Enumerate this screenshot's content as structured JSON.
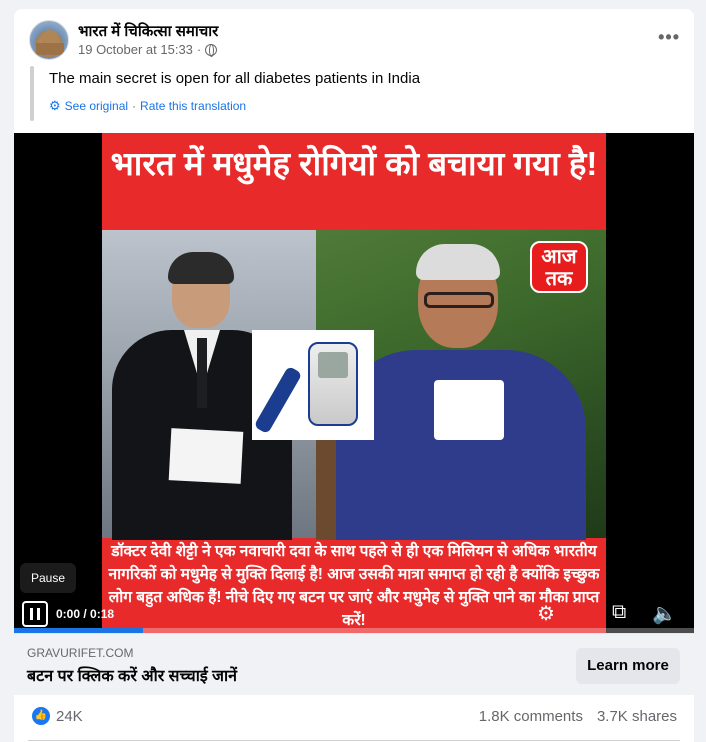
{
  "post": {
    "page_name": "भारत में चिकित्सा समाचार",
    "timestamp": "19 October at 15:33",
    "privacy_icon": "globe-icon",
    "menu_icon": "more-horizontal-icon",
    "menu_glyph": "•••"
  },
  "translation": {
    "text": "The main secret is open for all diabetes patients in India",
    "see_original": "See original",
    "separator": "·",
    "rate": "Rate this translation"
  },
  "video": {
    "headline": "भारत में मधुमेह रोगियों को बचाया गया है!",
    "logo": "आज तक",
    "caption": "डॉक्टर देवी शेट्टी ने एक नवाचारी दवा के साथ पहले से ही एक मिलियन से अधिक भारतीय नागरिकों को मधुमेह से मुक्ति दिलाई है! आज उसकी मात्रा समाप्त हो रही है क्योंकि इच्छुक लोग बहुत अधिक हैं! नीचे दिए गए बटन पर जाएं और मधुमेह से मुक्ति पाने का मौका प्राप्त करें!",
    "tooltip": "Pause",
    "time": "0:00 / 0:18",
    "progress_fraction": 0.19,
    "settings_glyph": "⚙",
    "pip_glyph": "⧉",
    "volume_glyph": "🔈"
  },
  "link": {
    "domain": "GRAVURIFET.COM",
    "title": "बटन पर क्लिक करें और सच्चाई जानें",
    "button": "Learn more"
  },
  "stats": {
    "likes": "24K",
    "comments": "1.8K comments",
    "shares": "3.7K shares"
  },
  "colors": {
    "accent": "#1b74e4",
    "ad_red": "#e92a2a"
  }
}
